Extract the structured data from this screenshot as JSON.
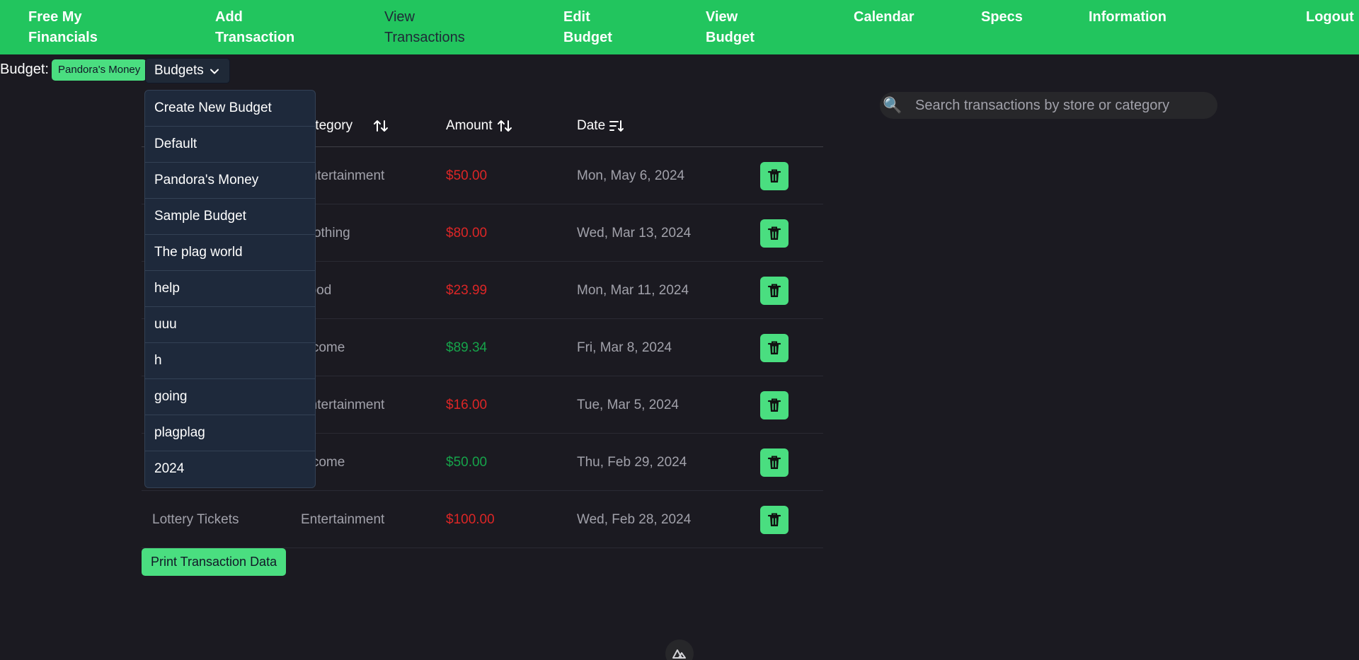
{
  "nav": {
    "brand": [
      "Free My",
      "Financials"
    ],
    "add_transaction": [
      "Add",
      "Transaction"
    ],
    "view_transactions": [
      "View",
      "Transactions"
    ],
    "edit_budget": [
      "Edit",
      "Budget"
    ],
    "view_budget": [
      "View",
      "Budget"
    ],
    "calendar": "Calendar",
    "specs": "Specs",
    "information": "Information",
    "logout": "Logout"
  },
  "budget": {
    "label": "Budget:",
    "current": "Pandora's Money",
    "dropdown_label": "Budgets",
    "options": [
      "Create New Budget",
      "Default",
      "Pandora's Money",
      "Sample Budget",
      "The plag world",
      "help",
      "uuu",
      "h",
      "going",
      "plagplag",
      "2024"
    ]
  },
  "table": {
    "headers": {
      "category": "Category",
      "amount": "Amount",
      "date": "Date"
    },
    "rows": [
      {
        "store": "",
        "category": "Entertainment",
        "amount": "$50.00",
        "date": "Mon, May 6, 2024",
        "type": "expense"
      },
      {
        "store": "",
        "category": "Clothing",
        "amount": "$80.00",
        "date": "Wed, Mar 13, 2024",
        "type": "expense"
      },
      {
        "store": "",
        "category": "Food",
        "amount": "$23.99",
        "date": "Mon, Mar 11, 2024",
        "type": "expense"
      },
      {
        "store": "",
        "category": "Income",
        "amount": "$89.34",
        "date": "Fri, Mar 8, 2024",
        "type": "income"
      },
      {
        "store": "",
        "category": "Entertainment",
        "amount": "$16.00",
        "date": "Tue, Mar 5, 2024",
        "type": "expense"
      },
      {
        "store": "",
        "category": "Income",
        "amount": "$50.00",
        "date": "Thu, Feb 29, 2024",
        "type": "income"
      },
      {
        "store": "Lottery Tickets",
        "category": "Entertainment",
        "amount": "$100.00",
        "date": "Wed, Feb 28, 2024",
        "type": "expense"
      }
    ]
  },
  "print_button": "Print Transaction Data",
  "search": {
    "placeholder": "Search transactions by store or category"
  },
  "colors": {
    "nav": "#22c55e",
    "accent": "#4ade80",
    "expense": "#dc2626",
    "income": "#16a34a",
    "background": "#1b1a21"
  },
  "icons": [
    "chevron-down-icon",
    "sort-icon",
    "sort-desc-icon",
    "trash-icon",
    "search-icon",
    "nuxt-logo-icon"
  ]
}
